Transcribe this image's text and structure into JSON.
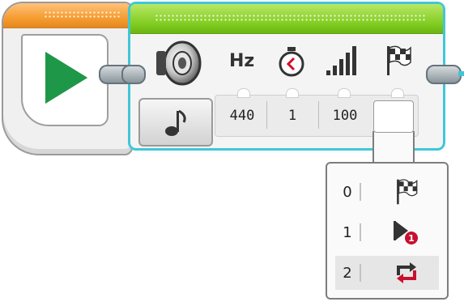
{
  "start_block": {
    "play_icon": "play-icon"
  },
  "sound_block": {
    "header_icon": "speaker-icon",
    "icons": [
      "speaker-icon",
      "frequency-icon",
      "timer-icon",
      "volume-icon",
      "flag-icon"
    ],
    "frequency_label": "Hz",
    "mode_icon": "music-note-icon",
    "params": {
      "frequency": "440",
      "duration": "1",
      "volume": "100"
    },
    "selected_value": ""
  },
  "dropdown": {
    "options": [
      {
        "value": "0",
        "icon": "checkered-flag-icon"
      },
      {
        "value": "1",
        "icon": "play-once-icon"
      },
      {
        "value": "2",
        "icon": "repeat-icon"
      }
    ]
  },
  "colors": {
    "start_header": "#f49a2d",
    "sound_header": "#7fcb1f",
    "selection_border": "#3fc7d8",
    "play": "#1e9848",
    "badge_red": "#c8102e"
  }
}
